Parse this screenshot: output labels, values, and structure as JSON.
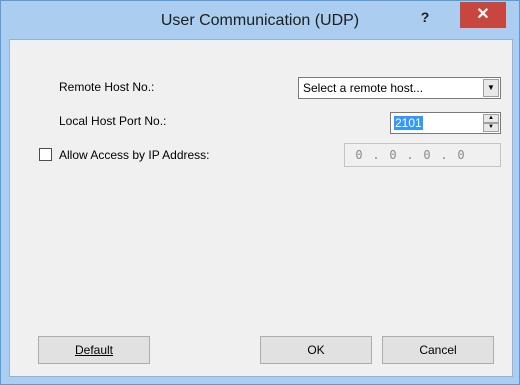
{
  "window": {
    "title": "User Communication (UDP)",
    "help_glyph": "?",
    "close_glyph": "✕"
  },
  "form": {
    "remote_host": {
      "label": "Remote Host No.:",
      "selected_value": "Select a remote host..."
    },
    "local_port": {
      "label": "Local Host Port No.:",
      "value": "2101"
    },
    "allow_ip": {
      "label": "Allow Access by IP Address:",
      "checked": false,
      "octets": [
        "0",
        "0",
        "0",
        "0"
      ]
    }
  },
  "buttons": {
    "default_label": "Default",
    "ok_label": "OK",
    "cancel_label": "Cancel"
  },
  "colors": {
    "title_bar": "#aacdf0",
    "close_button": "#c7463d",
    "selection": "#3399ff"
  }
}
